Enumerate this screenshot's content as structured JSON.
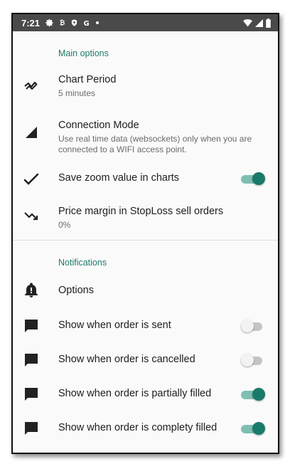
{
  "status_bar": {
    "time": "7:21",
    "left_icons": [
      "gear-icon",
      "bitcoin-icon",
      "shield-icon",
      "google-icon",
      "dot-icon"
    ],
    "right_icons": [
      "wifi-icon",
      "signal-icon",
      "battery-icon"
    ]
  },
  "main_options": {
    "header": "Main options",
    "chart_period": {
      "title": "Chart Period",
      "summary": "5 minutes",
      "icon": "trend-icon"
    },
    "connection_mode": {
      "title": "Connection Mode",
      "summary": "Use real time data (websockets) only when you are connected to a WIFI access point.",
      "icon": "signal-strength-icon"
    },
    "save_zoom": {
      "title": "Save zoom value in charts",
      "icon": "checkmark-icon",
      "enabled": true
    },
    "price_margin": {
      "title": "Price margin in StopLoss sell orders",
      "summary": "0%",
      "icon": "trending-down-icon"
    }
  },
  "notifications": {
    "header": "Notifications",
    "options": {
      "title": "Options",
      "icon": "bell-icon"
    },
    "order_sent": {
      "title": "Show when order is sent",
      "icon": "message-icon",
      "enabled": false
    },
    "order_cancelled": {
      "title": "Show when order is cancelled",
      "icon": "message-icon",
      "enabled": false
    },
    "order_partial": {
      "title": "Show when order is partially filled",
      "icon": "message-icon",
      "enabled": true
    },
    "order_complete": {
      "title": "Show when order is complety filled",
      "icon": "message-icon",
      "enabled": true
    }
  },
  "colors": {
    "accent": "#1a7a69",
    "status_bar": "#4a4a4a",
    "section_header": "#1f7a6b"
  }
}
